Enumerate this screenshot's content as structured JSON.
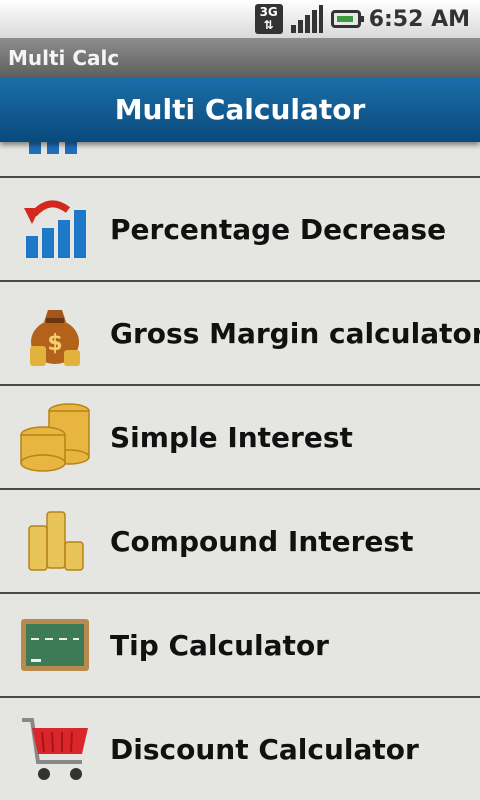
{
  "status_bar": {
    "network": "3G",
    "time": "6:52 AM"
  },
  "app_title": "Multi Calc",
  "header_title": "Multi Calculator",
  "list_items": [
    {
      "label": "Percentage Decrease",
      "icon": "bar-chart-down-icon"
    },
    {
      "label": "Gross Margin calculator",
      "icon": "money-bag-icon"
    },
    {
      "label": "Simple Interest",
      "icon": "coin-stacks-icon"
    },
    {
      "label": "Compound Interest",
      "icon": "coin-columns-icon"
    },
    {
      "label": "Tip Calculator",
      "icon": "chalkboard-icon"
    },
    {
      "label": "Discount Calculator",
      "icon": "shopping-cart-icon"
    }
  ],
  "colors": {
    "header_blue": "#0d5a92",
    "list_background": "#e5e6e1",
    "divider": "#4a4a4a"
  }
}
